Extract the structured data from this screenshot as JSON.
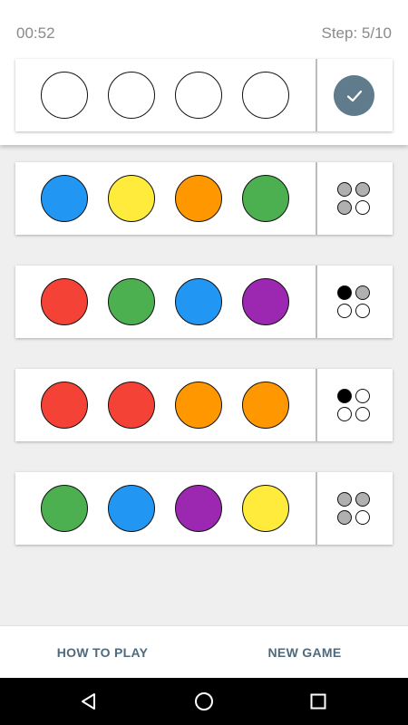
{
  "header": {
    "timer": "00:52",
    "step": "Step: 5/10"
  },
  "current_guess": {
    "pegs": [
      "empty",
      "empty",
      "empty",
      "empty"
    ],
    "submit_icon": "check-icon",
    "submit_color": "#5f7b8c"
  },
  "colors": {
    "empty": "#ffffff",
    "blue": "#2196f3",
    "yellow": "#ffeb3b",
    "orange": "#ff9800",
    "green": "#4caf50",
    "red": "#f44336",
    "purple": "#9c27b0",
    "black": "#000000",
    "gray": "#b0b0b0"
  },
  "guesses": [
    {
      "pegs": [
        "blue",
        "yellow",
        "orange",
        "green"
      ],
      "feedback": [
        "gray",
        "gray",
        "gray",
        "empty"
      ]
    },
    {
      "pegs": [
        "red",
        "green",
        "blue",
        "purple"
      ],
      "feedback": [
        "black",
        "gray",
        "empty",
        "empty"
      ]
    },
    {
      "pegs": [
        "red",
        "red",
        "orange",
        "orange"
      ],
      "feedback": [
        "black",
        "empty",
        "empty",
        "empty"
      ]
    },
    {
      "pegs": [
        "green",
        "blue",
        "purple",
        "yellow"
      ],
      "feedback": [
        "gray",
        "gray",
        "gray",
        "empty"
      ]
    }
  ],
  "bottom_bar": {
    "how_to_play_label": "HOW TO PLAY",
    "new_game_label": "NEW GAME"
  },
  "system_nav": {
    "back_icon": "back-triangle-icon",
    "home_icon": "home-circle-icon",
    "recent_icon": "recent-square-icon"
  }
}
